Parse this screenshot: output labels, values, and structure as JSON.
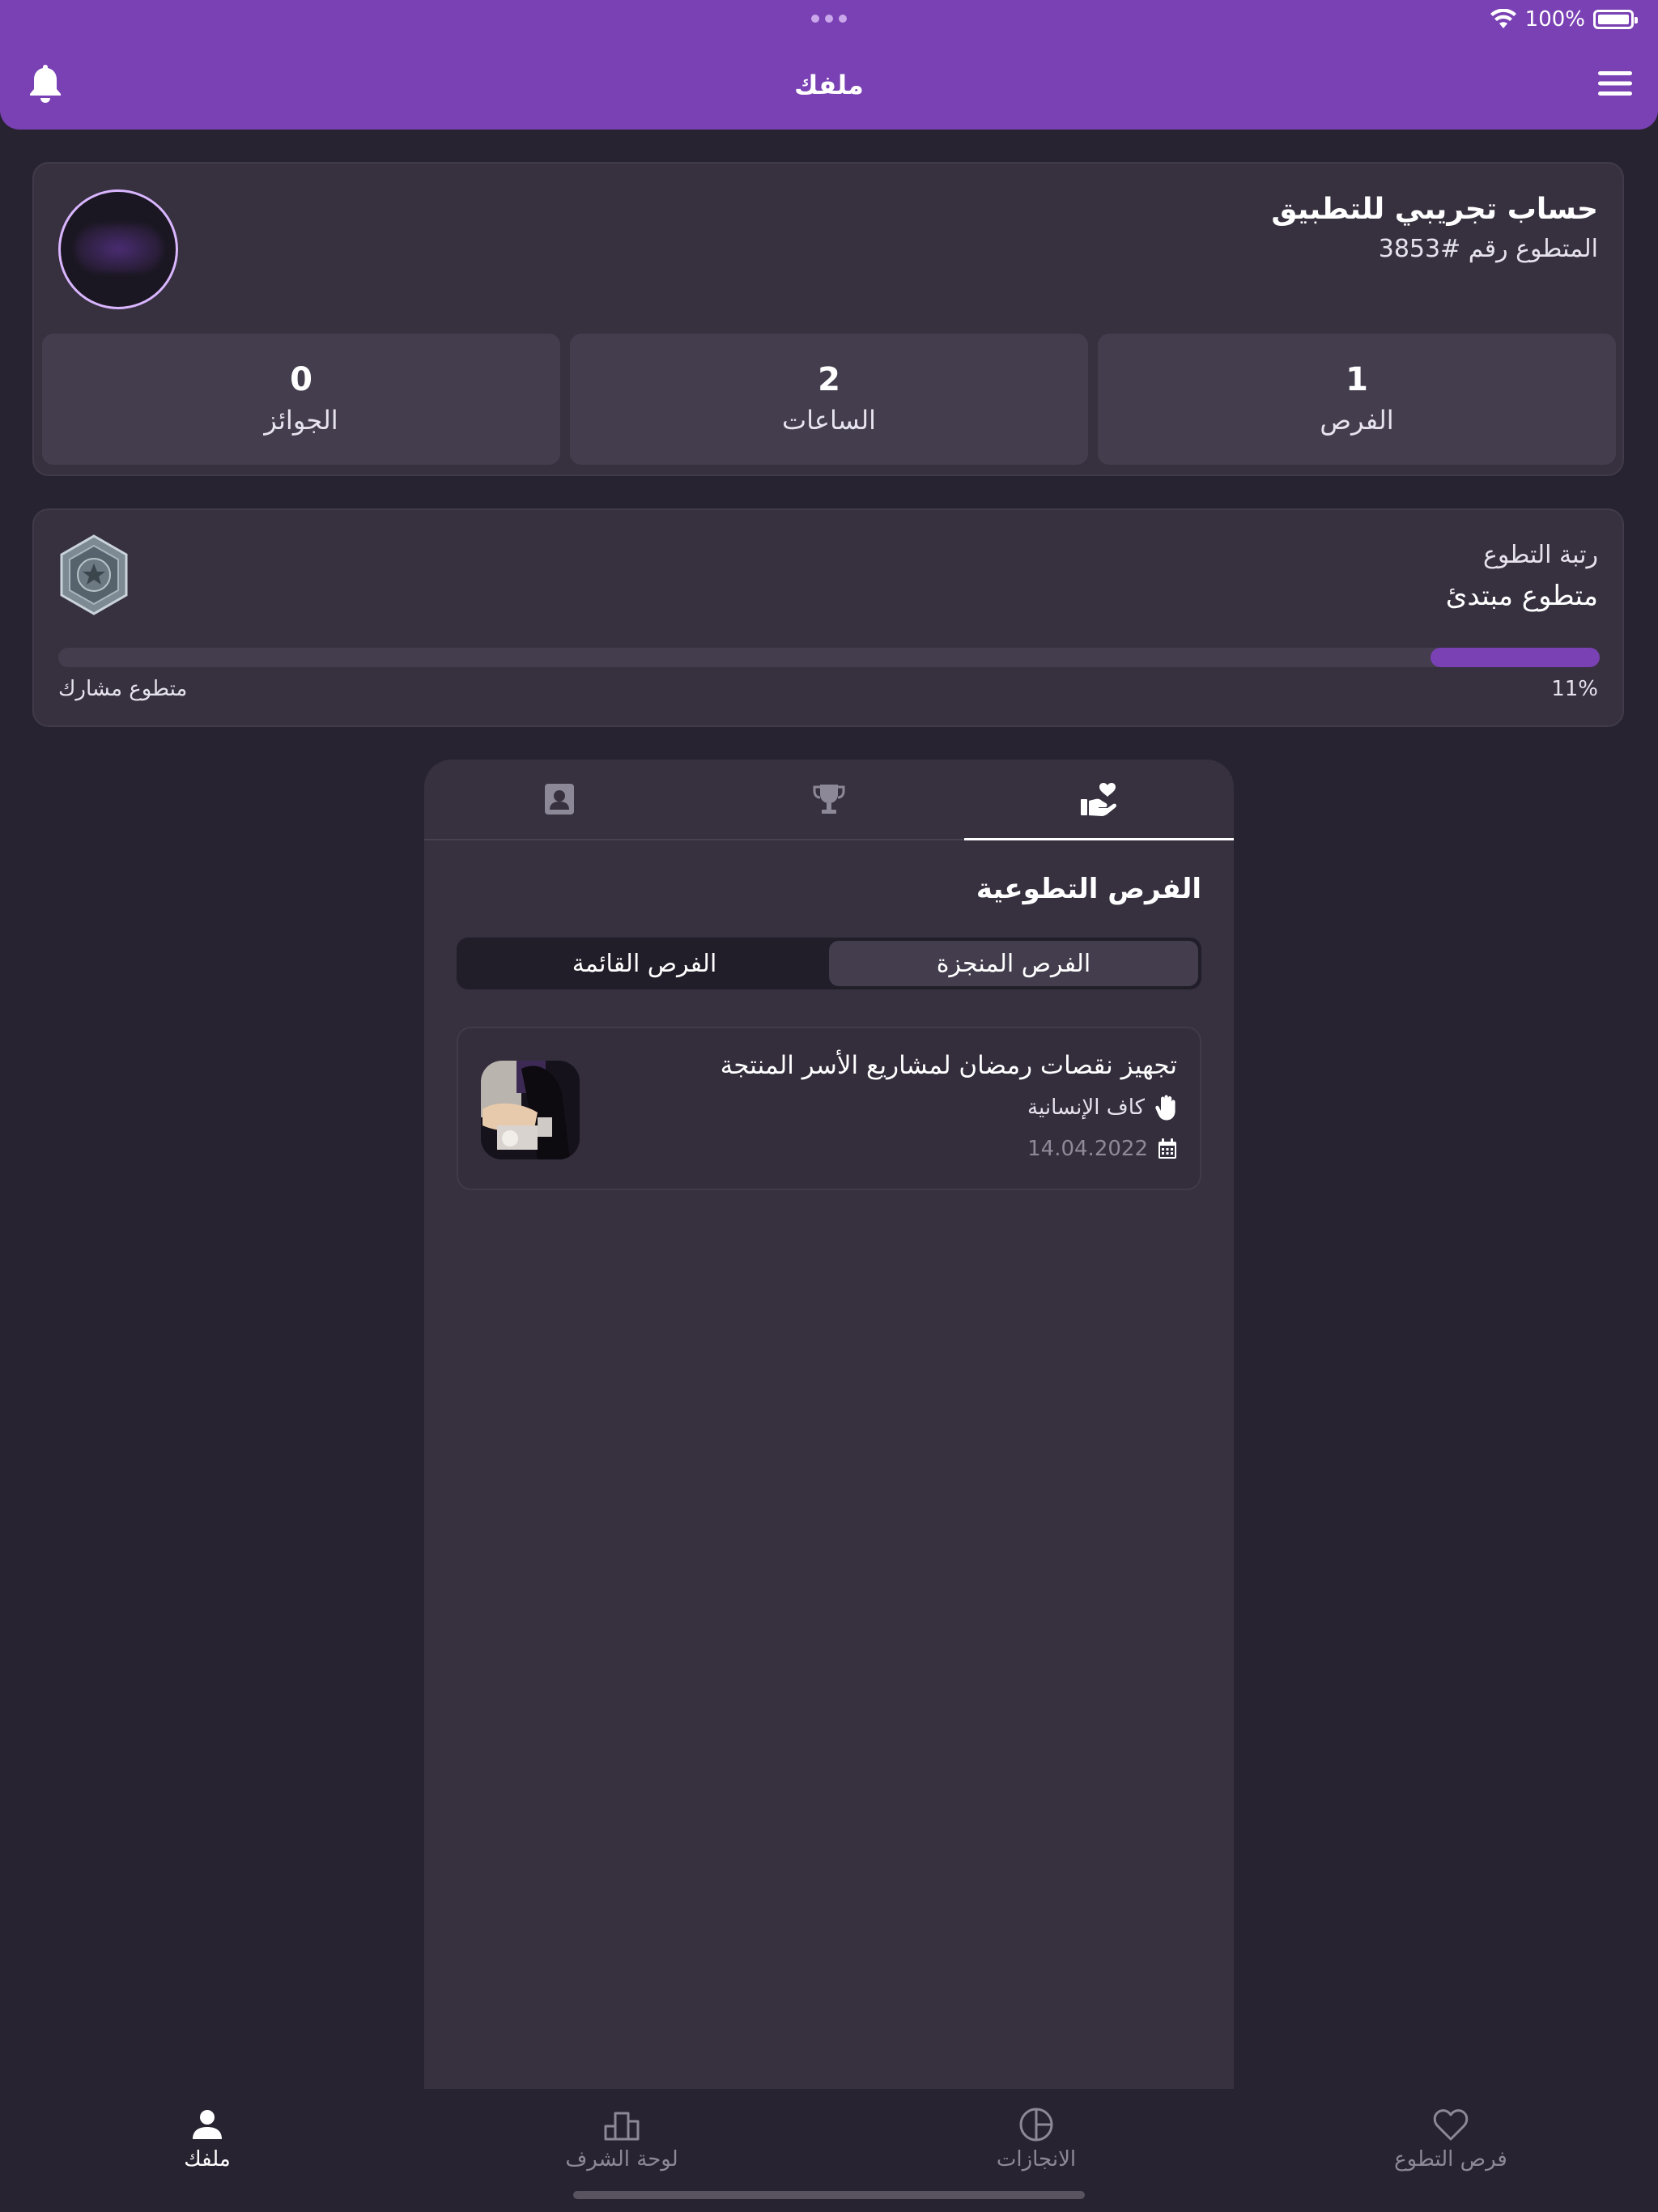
{
  "status_bar": {
    "battery": "100%"
  },
  "header": {
    "title": "ملفك"
  },
  "profile": {
    "name": "حساب تجريبي للتطبيق",
    "volunteer_id": "المتطوع رقم #3853",
    "stats": [
      {
        "value": "0",
        "label": "الجوائز"
      },
      {
        "value": "2",
        "label": "الساعات"
      },
      {
        "value": "1",
        "label": "الفرص"
      }
    ]
  },
  "rank": {
    "title": "رتبة التطوع",
    "current": "متطوع مبتدئ",
    "next": "متطوع مشارك",
    "percent_label": "11%",
    "progress": 0.11,
    "accent": "#7a41b4"
  },
  "tabs": {
    "icons": [
      "contact-card-icon",
      "trophy-icon",
      "volunteer-hand-heart-icon"
    ],
    "active_index": 2
  },
  "opportunities": {
    "section_title": "الفرص التطوعية",
    "segments": {
      "current": "الفرص القائمة",
      "completed": "الفرص المنجزة"
    },
    "items": [
      {
        "title": "تجهيز نقصات رمضان لمشاريع الأسر المنتجة",
        "organization": "كاف الإنسانية",
        "date": "14.04.2022"
      }
    ]
  },
  "bottom_nav": {
    "items": [
      {
        "label": "ملفك",
        "icon": "person-icon",
        "active": true
      },
      {
        "label": "لوحة الشرف",
        "icon": "leaderboard-icon",
        "active": false
      },
      {
        "label": "الانجازات",
        "icon": "pie-chart-icon",
        "active": false
      },
      {
        "label": "فرص التطوع",
        "icon": "heart-icon",
        "active": false
      }
    ]
  }
}
